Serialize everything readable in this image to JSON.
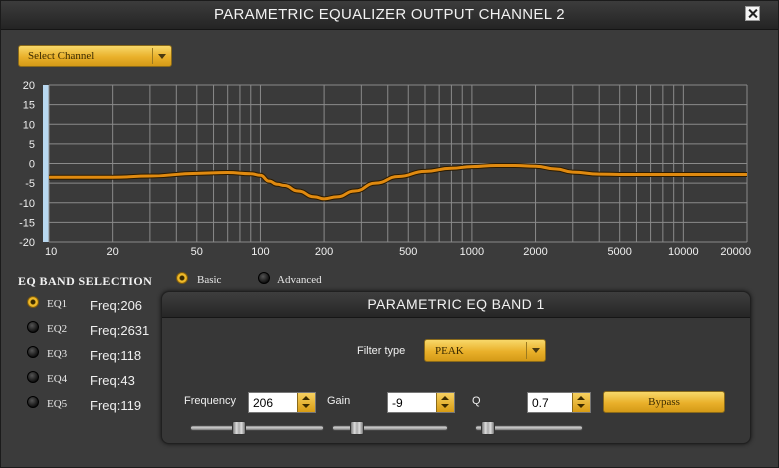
{
  "window": {
    "title": "PARAMETRIC EQUALIZER OUTPUT CHANNEL 2"
  },
  "channel_select": {
    "label": "Select Channel"
  },
  "chart_data": {
    "type": "line",
    "x_scale": "log",
    "xlim": [
      10,
      20000
    ],
    "ylim": [
      -20,
      20
    ],
    "x_ticks": [
      10,
      20,
      50,
      100,
      200,
      500,
      1000,
      2000,
      5000,
      10000,
      20000
    ],
    "x_tick_labels": [
      "10",
      "20",
      "50",
      "100",
      "200",
      "500",
      "1000",
      "2000",
      "5000",
      "10000",
      "20000"
    ],
    "y_ticks": [
      20,
      15,
      10,
      5,
      0,
      -5,
      -10,
      -15,
      -20
    ],
    "grid": true,
    "colors": {
      "background": "#3a3a3a",
      "grid": "#8a8a8a",
      "curve": "#e08a10",
      "highlight_band": "#b8d8f0"
    },
    "series": [
      {
        "x": [
          10,
          20,
          30,
          50,
          70,
          90,
          100,
          110,
          120,
          130,
          150,
          180,
          200,
          230,
          280,
          350,
          450,
          600,
          800,
          1000,
          1300,
          1600,
          2000,
          2500,
          3000,
          4000,
          5000,
          7000,
          10000,
          15000,
          20000
        ],
        "y": [
          -3.5,
          -3.5,
          -3.2,
          -2.5,
          -2.3,
          -2.6,
          -3.0,
          -4.5,
          -5.3,
          -5.6,
          -7.0,
          -8.5,
          -9.0,
          -8.5,
          -7.0,
          -5.0,
          -3.3,
          -2.0,
          -1.2,
          -0.8,
          -0.5,
          -0.5,
          -0.7,
          -1.4,
          -2.2,
          -2.7,
          -2.8,
          -2.8,
          -2.8,
          -2.8,
          -2.8
        ]
      }
    ]
  },
  "band_selection": {
    "title": "EQ BAND SELECTION",
    "bands": [
      {
        "label": "EQ1",
        "freq": "Freq:206",
        "selected": true
      },
      {
        "label": "EQ2",
        "freq": "Freq:2631",
        "selected": false
      },
      {
        "label": "EQ3",
        "freq": "Freq:118",
        "selected": false
      },
      {
        "label": "EQ4",
        "freq": "Freq:43",
        "selected": false
      },
      {
        "label": "EQ5",
        "freq": "Freq:119",
        "selected": false
      }
    ]
  },
  "mode": {
    "basic": "Basic",
    "advanced": "Advanced",
    "selected": "basic"
  },
  "band_panel": {
    "title": "PARAMETRIC EQ BAND 1",
    "filter_type_label": "Filter type",
    "filter_type_value": "PEAK",
    "frequency_label": "Frequency",
    "frequency_value": "206",
    "gain_label": "Gain",
    "gain_value": "-9",
    "q_label": "Q",
    "q_value": "0.7",
    "bypass_label": "Bypass",
    "frequency_slider_fraction": 0.35,
    "gain_slider_fraction": 0.17,
    "q_slider_fraction": 0.05
  }
}
